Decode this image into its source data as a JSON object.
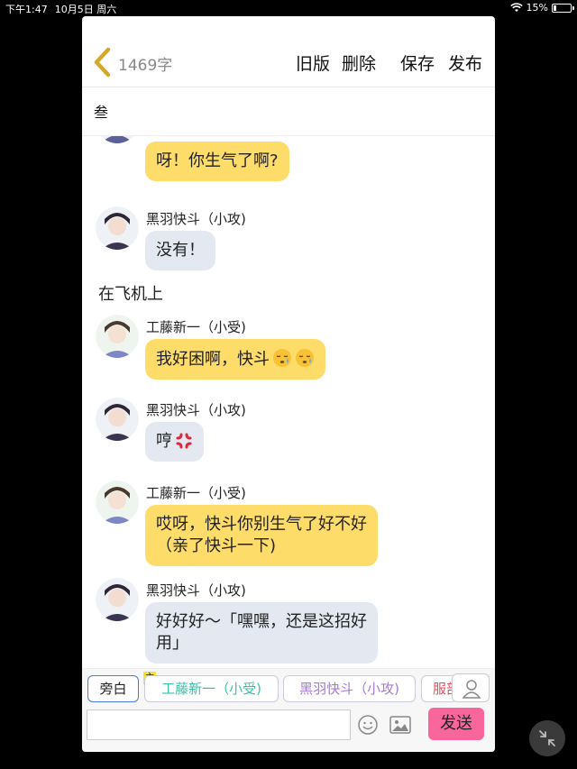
{
  "status_bar": {
    "time": "下午1:47",
    "date": "10月5日 周六",
    "battery_text": "15%",
    "battery_level": 0.15
  },
  "header": {
    "word_count": "1469字",
    "old_version_label": "旧版",
    "delete_label": "删除",
    "save_label": "保存",
    "publish_label": "发布"
  },
  "chapter": {
    "title": "叁"
  },
  "chat": {
    "messages": [
      {
        "type": "dialogue",
        "speaker": "",
        "text": "呀！你生气了啊?",
        "style": "yellow"
      },
      {
        "type": "dialogue",
        "speaker": "黑羽快斗（小攻)",
        "text": "没有！",
        "style": "gray"
      },
      {
        "type": "narration",
        "text": "在飞机上"
      },
      {
        "type": "dialogue",
        "speaker": "工藤新一（小受)",
        "text": "我好困啊，快斗",
        "emoji": [
          "sleepy-face",
          "sleepy-face"
        ],
        "style": "yellow"
      },
      {
        "type": "dialogue",
        "speaker": "黑羽快斗（小攻)",
        "text": "哼",
        "emoji": [
          "anger-symbol"
        ],
        "style": "gray"
      },
      {
        "type": "dialogue",
        "speaker": "工藤新一（小受)",
        "lines": [
          "哎呀，快斗你别生气了好不好",
          "（亲了快斗一下)"
        ],
        "style": "yellow"
      },
      {
        "type": "dialogue",
        "speaker": "黑羽快斗（小攻)",
        "lines": [
          "好好好～「嘿嘿，还是这招好",
          "用」"
        ],
        "style": "gray"
      }
    ]
  },
  "roles": {
    "narration_label": "旁白",
    "host_badge": "主",
    "role1": "工藤新一（小受)",
    "role2": "黑羽快斗（小攻)",
    "role3": "服部"
  },
  "input": {
    "value": "",
    "placeholder": ""
  },
  "send_label": "发送",
  "colors": {
    "yellow_bubble": "#fddc6a",
    "gray_bubble": "#e3e8f1",
    "send_button": "#f9669c",
    "role1_text": "#3dbfa5",
    "role2_text": "#a57ad4",
    "role3_text": "#e74c5c",
    "back_arrow": "#d4a92a"
  }
}
